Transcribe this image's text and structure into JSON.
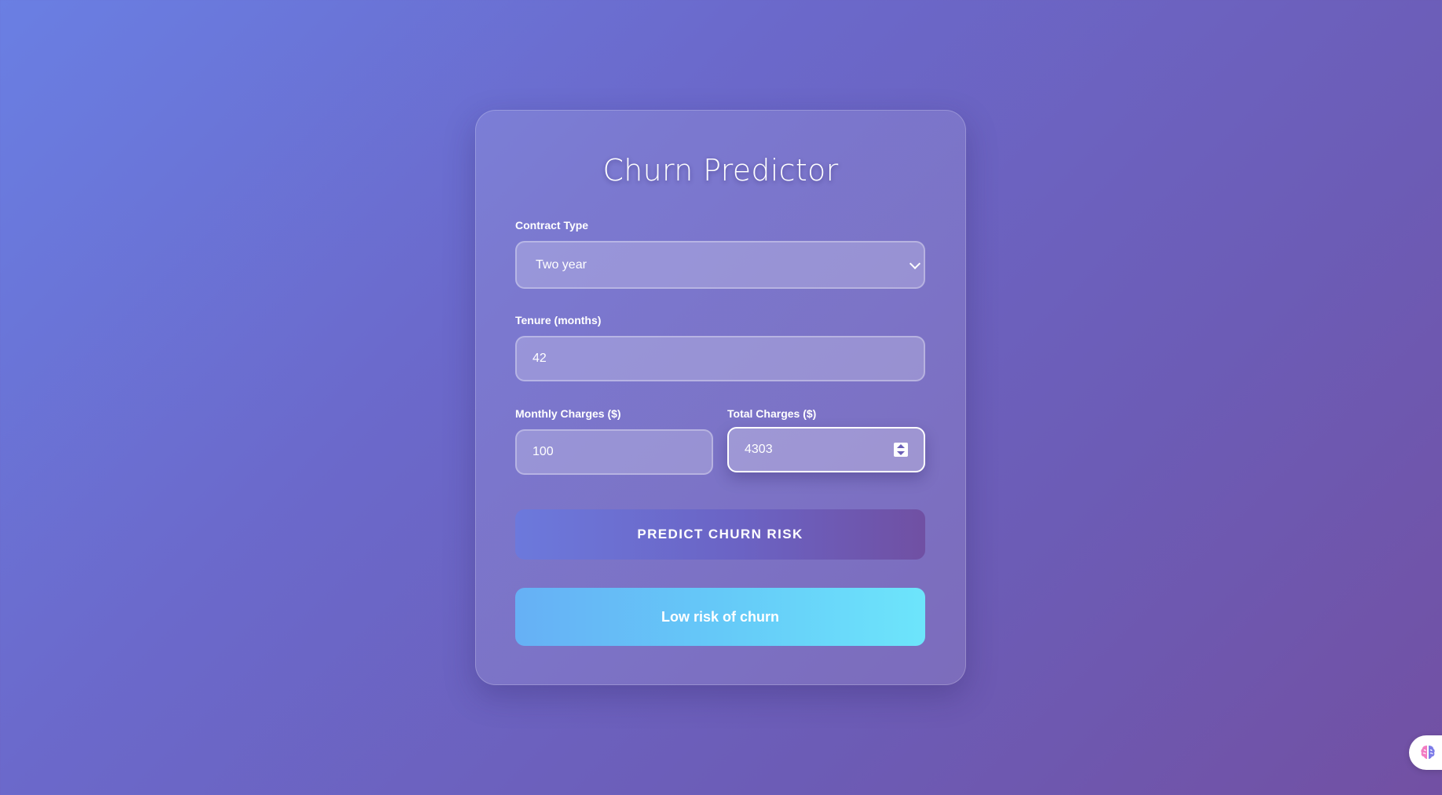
{
  "title": "Churn Predictor",
  "contract": {
    "label": "Contract Type",
    "value": "Two year"
  },
  "tenure": {
    "label": "Tenure (months)",
    "value": "42"
  },
  "monthly": {
    "label": "Monthly Charges ($)",
    "value": "100"
  },
  "total": {
    "label": "Total Charges ($)",
    "value": "4303"
  },
  "predict_button": "PREDICT CHURN RISK",
  "result": "Low risk of churn",
  "icons": {
    "select_chevron": "chevron-down-icon",
    "number_spinner": "spinner-icon",
    "assistant": "brain-icon"
  },
  "colors": {
    "bg_start": "#6a7fe3",
    "bg_end": "#7250a3",
    "result_start": "#66b0f5",
    "result_end": "#6de5fb"
  }
}
